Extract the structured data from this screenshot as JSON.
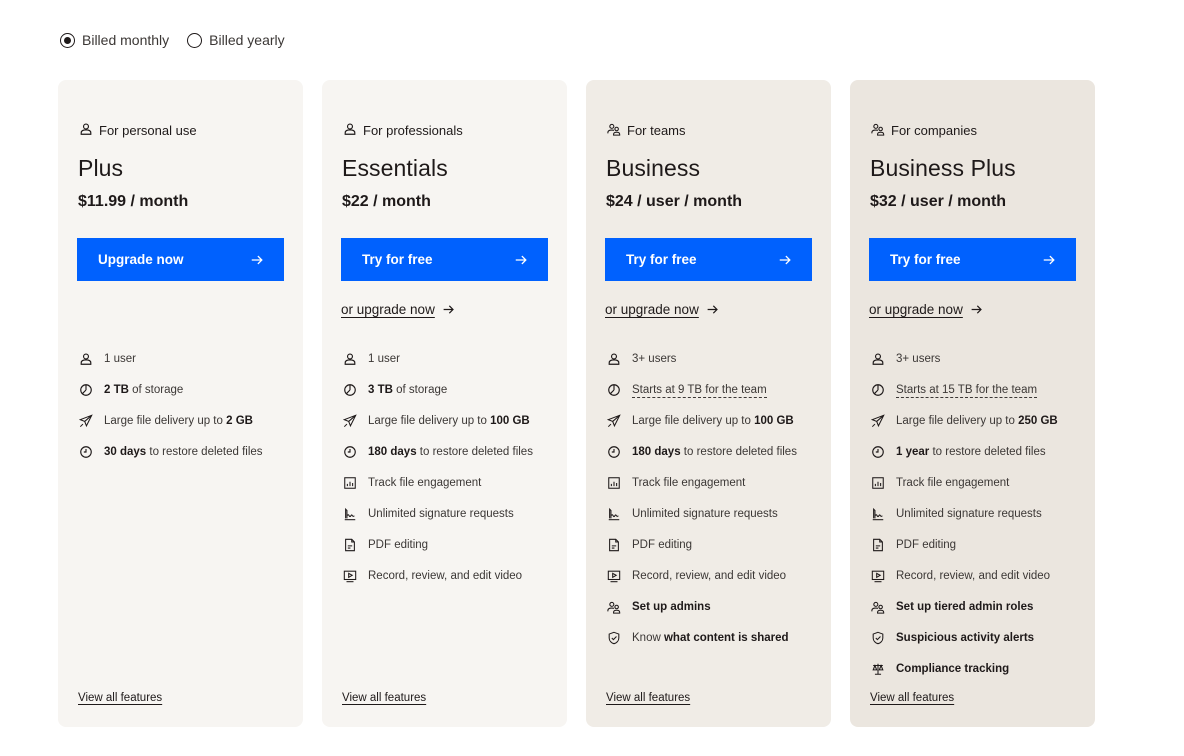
{
  "billing": {
    "options": [
      {
        "label": "Billed monthly",
        "selected": true
      },
      {
        "label": "Billed yearly",
        "selected": false
      }
    ]
  },
  "colors": {
    "cta": "#0061fe",
    "card_light": "#f7f5f2",
    "card_teams": "#f0ece6",
    "card_companies": "#ebe6df"
  },
  "plans": [
    {
      "audience": "For personal use",
      "audience_icon": "person-icon",
      "name": "Plus",
      "price": "$11.99 / month",
      "cta": "Upgrade now",
      "upgrade_link": "",
      "features": [
        {
          "icon": "person-icon",
          "bold": "",
          "text": "1 user"
        },
        {
          "icon": "storage-icon",
          "bold": "2 TB",
          "text": " of storage"
        },
        {
          "icon": "paper-plane-icon",
          "bold": "",
          "text": "Large file delivery up to ",
          "bold_after": "2 GB"
        },
        {
          "icon": "clock-icon",
          "bold": "30 days",
          "text": " to restore deleted files"
        }
      ],
      "view_all": "View all features"
    },
    {
      "audience": "For professionals",
      "audience_icon": "person-icon",
      "name": "Essentials",
      "price": "$22 / month",
      "cta": "Try for free",
      "upgrade_link": "or upgrade now",
      "features": [
        {
          "icon": "person-icon",
          "bold": "",
          "text": "1 user"
        },
        {
          "icon": "storage-icon",
          "bold": "3 TB",
          "text": " of storage"
        },
        {
          "icon": "paper-plane-icon",
          "bold": "",
          "text": "Large file delivery up to ",
          "bold_after": "100 GB"
        },
        {
          "icon": "clock-icon",
          "bold": "180 days",
          "text": " to restore deleted files"
        },
        {
          "icon": "chart-icon",
          "bold": "",
          "text": "Track file engagement"
        },
        {
          "icon": "signature-icon",
          "bold": "",
          "text": "Unlimited signature requests"
        },
        {
          "icon": "pdf-icon",
          "bold": "",
          "text": "PDF editing"
        },
        {
          "icon": "video-icon",
          "bold": "",
          "text": "Record, review, and edit video"
        }
      ],
      "view_all": "View all features"
    },
    {
      "audience": "For teams",
      "audience_icon": "team-icon",
      "name": "Business",
      "price": "$24 / user / month",
      "cta": "Try for free",
      "upgrade_link": "or upgrade now",
      "features": [
        {
          "icon": "person-icon",
          "bold": "",
          "text": "3+ users"
        },
        {
          "icon": "storage-icon",
          "bold": "",
          "text": "",
          "dashed": "Starts at 9 TB for the team"
        },
        {
          "icon": "paper-plane-icon",
          "bold": "",
          "text": "Large file delivery up to ",
          "bold_after": "100 GB"
        },
        {
          "icon": "clock-icon",
          "bold": "180 days",
          "text": " to restore deleted files"
        },
        {
          "icon": "chart-icon",
          "bold": "",
          "text": "Track file engagement"
        },
        {
          "icon": "signature-icon",
          "bold": "",
          "text": "Unlimited signature requests"
        },
        {
          "icon": "pdf-icon",
          "bold": "",
          "text": "PDF editing"
        },
        {
          "icon": "video-icon",
          "bold": "",
          "text": "Record, review, and edit video"
        },
        {
          "icon": "team-icon",
          "bold": "Set up admins",
          "text": ""
        },
        {
          "icon": "shield-icon",
          "bold": "",
          "text": "Know ",
          "bold_after": "what content is shared"
        }
      ],
      "view_all": "View all features"
    },
    {
      "audience": "For companies",
      "audience_icon": "team-icon",
      "name": "Business Plus",
      "price": "$32 / user / month",
      "cta": "Try for free",
      "upgrade_link": "or upgrade now",
      "features": [
        {
          "icon": "person-icon",
          "bold": "",
          "text": "3+ users"
        },
        {
          "icon": "storage-icon",
          "bold": "",
          "text": "",
          "dashed": "Starts at 15 TB for the team"
        },
        {
          "icon": "paper-plane-icon",
          "bold": "",
          "text": "Large file delivery up to ",
          "bold_after": "250 GB"
        },
        {
          "icon": "clock-icon",
          "bold": "1 year",
          "text": " to restore deleted files"
        },
        {
          "icon": "chart-icon",
          "bold": "",
          "text": "Track file engagement"
        },
        {
          "icon": "signature-icon",
          "bold": "",
          "text": "Unlimited signature requests"
        },
        {
          "icon": "pdf-icon",
          "bold": "",
          "text": "PDF editing"
        },
        {
          "icon": "video-icon",
          "bold": "",
          "text": "Record, review, and edit video"
        },
        {
          "icon": "team-icon",
          "bold": "Set up tiered admin roles",
          "text": ""
        },
        {
          "icon": "shield-icon",
          "bold": "Suspicious activity alerts",
          "text": ""
        },
        {
          "icon": "scales-icon",
          "bold": "Compliance tracking",
          "text": ""
        }
      ],
      "view_all": "View all features"
    }
  ]
}
